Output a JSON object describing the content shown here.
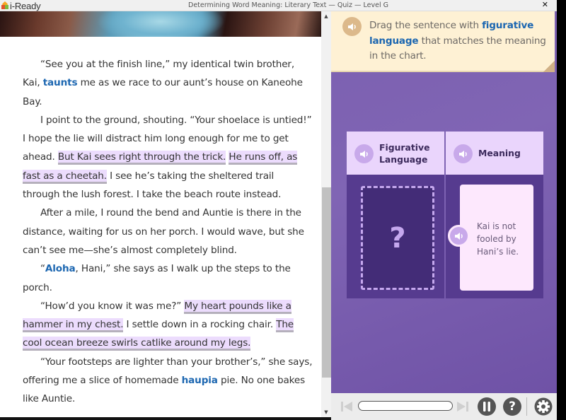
{
  "app": {
    "logo_text": "i-Ready",
    "window_title": "Determining Word Meaning: Literary Text — Quiz — Level G",
    "close_label": "✕"
  },
  "passage": {
    "paragraphs": [
      {
        "segments": [
          {
            "type": "text",
            "text": "“See you at the finish line,” my identical twin brother, Kai, "
          },
          {
            "type": "vocab",
            "text": "taunts"
          },
          {
            "type": "text",
            "text": " me as we race to our aunt’s house on Kaneohe Bay."
          }
        ]
      },
      {
        "segments": [
          {
            "type": "text",
            "text": "I point to the ground, shouting. “Your shoelace is untied!” I hope the lie will distract him long enough for me to get ahead. "
          },
          {
            "type": "figurative",
            "text": "But Kai sees right through the trick."
          },
          {
            "type": "text",
            "text": " "
          },
          {
            "type": "figurative",
            "text": "He runs off, as fast as a cheetah."
          },
          {
            "type": "text",
            "text": " I see he’s taking the sheltered trail through the lush forest. I take the beach route instead."
          }
        ]
      },
      {
        "segments": [
          {
            "type": "text",
            "text": "After a mile, I round the bend and Auntie is there in the distance, waiting for us on her porch. I would wave, but she can’t see me—she’s almost completely blind."
          }
        ]
      },
      {
        "segments": [
          {
            "type": "text",
            "text": "“"
          },
          {
            "type": "vocab",
            "text": "Aloha"
          },
          {
            "type": "text",
            "text": ", Hani,” she says as I walk up the steps to the porch."
          }
        ]
      },
      {
        "segments": [
          {
            "type": "text",
            "text": "“How’d you know it was me?” "
          },
          {
            "type": "figurative",
            "text": "My heart pounds like a hammer in my chest."
          },
          {
            "type": "text",
            "text": " I settle down in a rocking chair. "
          },
          {
            "type": "figurative",
            "text": "The cool ocean breeze swirls catlike around my legs."
          }
        ]
      },
      {
        "segments": [
          {
            "type": "text",
            "text": "“Your footsteps are lighter than your brother’s,” she says, offering me a slice of homemade "
          },
          {
            "type": "vocab",
            "text": "haupia"
          },
          {
            "type": "text",
            "text": " pie. No one bakes like Auntie."
          }
        ]
      }
    ]
  },
  "question": {
    "prompt_parts": [
      {
        "type": "text",
        "text": "Drag the sentence with "
      },
      {
        "type": "key",
        "text": "figurative language"
      },
      {
        "type": "text",
        "text": " that matches the meaning in the chart."
      }
    ],
    "chart": {
      "columns": [
        {
          "header": "Figurative Language",
          "header_lines": [
            "Figurative",
            "Language"
          ]
        },
        {
          "header": "Meaning",
          "header_lines": [
            "Meaning"
          ]
        }
      ],
      "drop_zone_placeholder": "?",
      "meaning_text": "Kai is not fooled by Hani’s lie."
    }
  },
  "toolbar": {
    "prev_icon": "skip-back-icon",
    "next_icon": "skip-forward-icon",
    "progress_fraction": 0.0,
    "pause_icon": "pause-icon",
    "help_label": "?",
    "settings_icon": "gear-icon"
  },
  "colors": {
    "vocab": "#1d67b1",
    "figurative_highlight": "#ecdcfd",
    "prompt_bg": "#fef1d4",
    "panel_purple": "#7b5fb0",
    "chart_header": "#ead5fc",
    "chart_body": "#563b8f",
    "meaning_card": "#fde8fd"
  }
}
